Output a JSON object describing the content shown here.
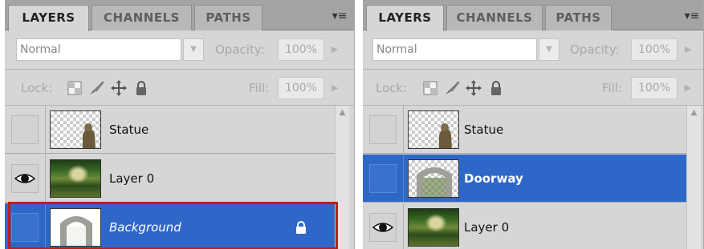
{
  "panels": [
    {
      "tabs": [
        "LAYERS",
        "CHANNELS",
        "PATHS"
      ],
      "blend_mode": "Normal",
      "opacity_label": "Opacity:",
      "opacity_value": "100%",
      "lock_label": "Lock:",
      "fill_label": "Fill:",
      "fill_value": "100%",
      "layers": [
        {
          "name": "Statue",
          "visible": false,
          "selected": false
        },
        {
          "name": "Layer 0",
          "visible": true,
          "selected": false
        },
        {
          "name": "Background",
          "visible": false,
          "selected": true,
          "locked": true
        }
      ]
    },
    {
      "tabs": [
        "LAYERS",
        "CHANNELS",
        "PATHS"
      ],
      "blend_mode": "Normal",
      "opacity_label": "Opacity:",
      "opacity_value": "100%",
      "lock_label": "Lock:",
      "fill_label": "Fill:",
      "fill_value": "100%",
      "layers": [
        {
          "name": "Statue",
          "visible": false,
          "selected": false
        },
        {
          "name": "Doorway",
          "visible": false,
          "selected": true
        },
        {
          "name": "Layer 0",
          "visible": true,
          "selected": false
        }
      ]
    }
  ],
  "icons": {
    "panel_menu": "panel-menu-icon",
    "dropdown": "chevron-down-icon",
    "slider": "chevron-right-icon",
    "lock_transparent": "lock-transparent-pixels-icon",
    "lock_image": "brush-icon",
    "lock_position": "move-icon",
    "lock_all": "padlock-icon",
    "visibility": "eye-icon",
    "layer_lock": "lock-icon",
    "scroll_up": "scroll-up-icon"
  },
  "colors": {
    "selection": "#2f67c9",
    "highlight_border": "#c21b1b",
    "panel_bg": "#d6d6d6",
    "tab_bar": "#a4a4a4"
  }
}
